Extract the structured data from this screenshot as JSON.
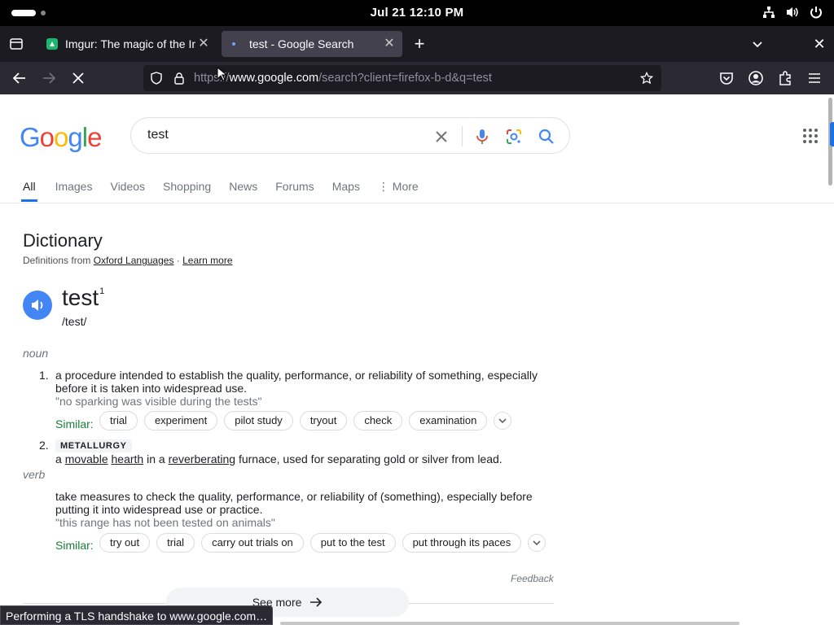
{
  "system_bar": {
    "clock": "Jul 21  12:10 PM",
    "icons": [
      "network-icon",
      "volume-icon",
      "power-icon"
    ]
  },
  "browser": {
    "tabs": [
      {
        "title": "Imgur: The magic of the Internet",
        "active": false,
        "favicon": "imgur-icon"
      },
      {
        "title": "test - Google Search",
        "active": true,
        "favicon": "loading-icon"
      }
    ],
    "url": {
      "scheme": "https://",
      "host": "www.google.com",
      "path": "/search?client=firefox-b-d&q=test"
    },
    "status_text": "Performing a TLS handshake to www.google.com…"
  },
  "google": {
    "query": "test",
    "nav_tabs": [
      "All",
      "Images",
      "Videos",
      "Shopping",
      "News",
      "Forums",
      "Maps",
      "⋮ More"
    ],
    "selected_tab": "All"
  },
  "dictionary": {
    "title": "Dictionary",
    "source_prefix": "Definitions from ",
    "source_link": "Oxford Languages",
    "source_sep": " · ",
    "learn_more": "Learn more",
    "word": "test",
    "superscript": "1",
    "phonetic": "/test/",
    "noun": {
      "pos": "noun",
      "sense1": {
        "number": "1.",
        "definition_line1": "a procedure intended to establish the quality, performance, or reliability of something, especially",
        "definition_line2": "before it is taken into widespread use.",
        "example": "\"no sparking was visible during the tests\"",
        "similar_label": "Similar:",
        "similar": [
          "trial",
          "experiment",
          "pilot study",
          "tryout",
          "check",
          "examination"
        ]
      },
      "sense2": {
        "number": "2.",
        "label": "METALLURGY",
        "w1": "a ",
        "link1": "movable",
        "w2": " ",
        "link2": "hearth",
        "w3": " in a ",
        "link3": "reverberating",
        "w4": " furnace, used for separating gold or silver from lead."
      }
    },
    "verb": {
      "pos": "verb",
      "definition_line1": "take measures to check the quality, performance, or reliability of (something), especially before",
      "definition_line2": "putting it into widespread use or practice.",
      "example": "\"this range has not been tested on animals\"",
      "similar_label": "Similar:",
      "similar": [
        "try out",
        "trial",
        "carry out trials on",
        "put to the test",
        "put through its paces"
      ]
    },
    "feedback": "Feedback",
    "see_more": "See more"
  },
  "colors": {
    "accent": "#1a73e8",
    "similar_green": "#188038",
    "browser_dark": "#1c1b22"
  }
}
